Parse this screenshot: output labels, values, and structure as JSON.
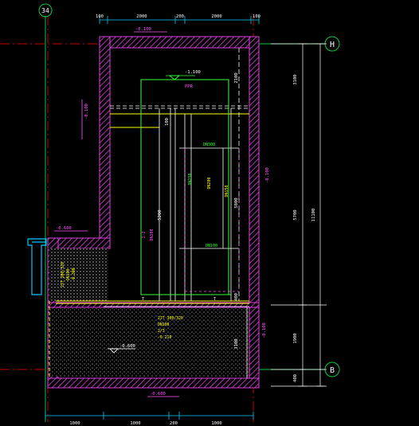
{
  "grid_axes": {
    "left": "34",
    "right_top": "H",
    "right_bottom": "B"
  },
  "dims_top": [
    "100",
    "2000",
    "200",
    "2000",
    "100"
  ],
  "dims_bottom": [
    "1000",
    "1000",
    "200",
    "1000"
  ],
  "dims_right_outer": [
    "3100",
    "5700",
    "1900",
    "400"
  ],
  "dims_right_total": "11100",
  "dims_inner_right": [
    "2100",
    "5800",
    "400"
  ],
  "dims_inner_left": [
    "100",
    "5200"
  ],
  "dims_lower": [
    "3100"
  ],
  "elev_labels": {
    "roof": "-0.100",
    "top_pipe": "-1.100",
    "left_wall": "-0.100",
    "step": "-0.600",
    "wall_right": "-0.100",
    "lower_right": "-0.100",
    "slab": "-0.600",
    "bottom": "-0.600"
  },
  "notes": {
    "pipe_tag": "PPR",
    "pipe_main": "DN300",
    "pipe_a": "DN250",
    "pipe_b": "DN200",
    "pipe_c": "DN150",
    "pipe_d": "DN100",
    "cell_block": [
      "2JT 200/320",
      "DN100",
      "-0.300"
    ],
    "lower_block": [
      "2JT 300/320",
      "DN100",
      "2/3",
      "-0.210"
    ],
    "misc": [
      "T",
      "T",
      "1:2"
    ]
  },
  "colors": {
    "wall": "#e040e0",
    "dim": "#00c8ff",
    "grid": "#00cc44",
    "pipe_green": "#33ff33",
    "pipe_white": "#ffffff",
    "yellow": "#ffff00",
    "red_axis": "#cc0000",
    "text_mag": "#ff55ff"
  }
}
